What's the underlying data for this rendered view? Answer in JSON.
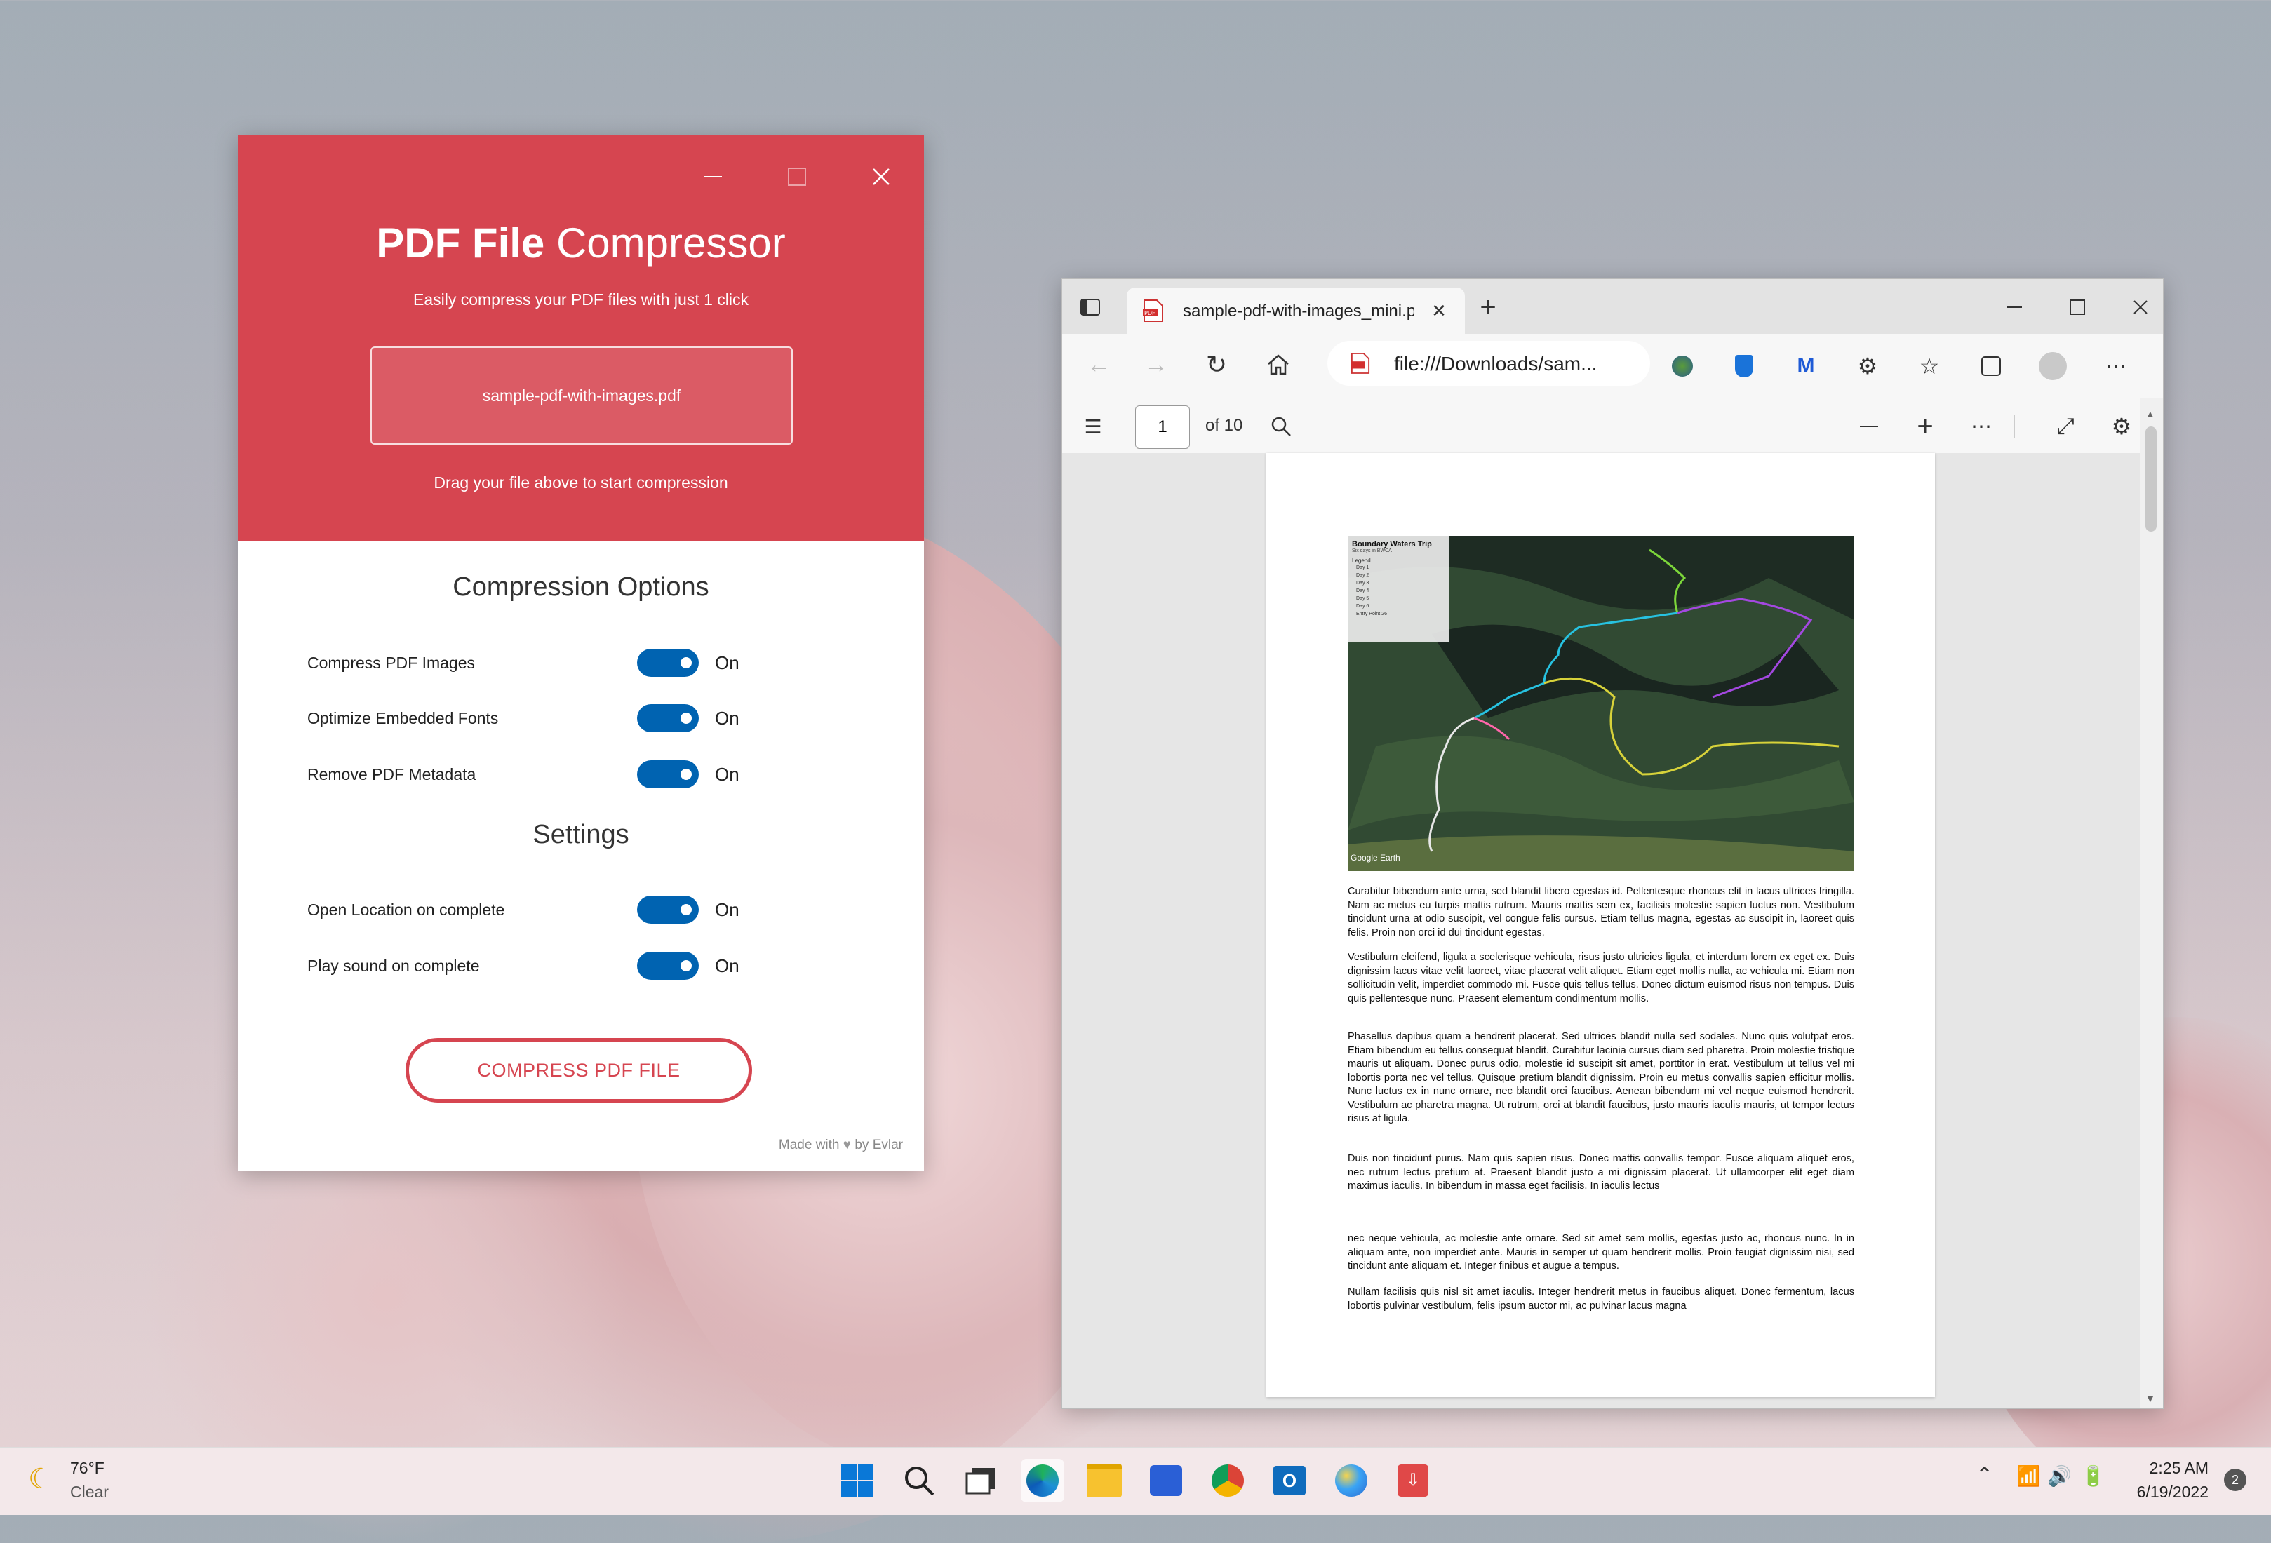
{
  "compressor": {
    "title_bold": "PDF File",
    "title_light": "Compressor",
    "subtitle": "Easily compress your PDF files with just 1 click",
    "file_name": "sample-pdf-with-images.pdf",
    "drag_hint": "Drag your file above to start compression",
    "compression_section": "Compression Options",
    "settings_section": "Settings",
    "options": [
      {
        "label": "Compress PDF Images",
        "state": "On"
      },
      {
        "label": "Optimize Embedded Fonts",
        "state": "On"
      },
      {
        "label": "Remove PDF Metadata",
        "state": "On"
      }
    ],
    "settings": [
      {
        "label": "Open Location on complete",
        "state": "On"
      },
      {
        "label": "Play sound on complete",
        "state": "On"
      }
    ],
    "compress_button": "COMPRESS PDF FILE",
    "made_with": "Made with",
    "by": "by Evlar",
    "accent": "#d64550",
    "toggle_color": "#0063b1"
  },
  "browser": {
    "tab_title": "sample-pdf-with-images_mini.pdf",
    "address": "file:///Downloads/sam...",
    "page_number": "1",
    "page_total": "of 10",
    "map": {
      "title": "Boundary Waters Trip",
      "subtitle": "Six days in BWCA",
      "legend_title": "Legend",
      "legend_items": [
        "Day 1",
        "Day 2",
        "Day 3",
        "Day 4",
        "Day 5",
        "Day 6",
        "Entry Point 26"
      ],
      "watermark": "Google Earth"
    },
    "paragraphs": [
      "Curabitur bibendum ante urna, sed blandit libero egestas id. Pellentesque rhoncus elit in lacus ultrices fringilla. Nam ac metus eu turpis mattis rutrum. Mauris mattis sem ex, facilisis molestie sapien luctus non. Vestibulum tincidunt urna at odio suscipit, vel congue felis cursus. Etiam tellus magna, egestas ac suscipit in, laoreet quis felis. Proin non orci id dui tincidunt egestas.",
      "Vestibulum eleifend, ligula a scelerisque vehicula, risus justo ultricies ligula, et interdum lorem ex eget ex. Duis dignissim lacus vitae velit laoreet, vitae placerat velit aliquet. Etiam eget mollis nulla, ac vehicula mi. Etiam non sollicitudin velit, imperdiet commodo mi. Fusce quis tellus tellus. Donec dictum euismod risus non tempus. Duis quis pellentesque nunc. Praesent elementum condimentum mollis.",
      "Phasellus dapibus quam a hendrerit placerat. Sed ultrices blandit nulla sed sodales. Nunc quis volutpat eros. Etiam bibendum eu tellus consequat blandit. Curabitur lacinia cursus diam sed pharetra. Proin molestie tristique mauris ut aliquam. Donec purus odio, molestie id suscipit sit amet, porttitor in erat. Vestibulum ut tellus vel mi lobortis porta nec vel tellus. Quisque pretium blandit dignissim. Proin eu metus convallis sapien efficitur mollis. Nunc luctus ex in nunc ornare, nec blandit orci faucibus. Aenean bibendum mi vel neque euismod hendrerit. Vestibulum ac pharetra magna. Ut rutrum, orci at blandit faucibus, justo mauris iaculis mauris, ut tempor lectus risus at ligula.",
      "Duis non tincidunt purus. Nam quis sapien risus. Donec mattis convallis tempor. Fusce aliquam aliquet eros, nec rutrum lectus pretium at. Praesent blandit justo a mi dignissim placerat. Ut ullamcorper elit eget diam maximus iaculis. In bibendum in massa eget facilisis. In iaculis lectus",
      "nec neque vehicula, ac molestie ante ornare. Sed sit amet sem mollis, egestas justo ac, rhoncus nunc. In in aliquam ante, non imperdiet ante. Mauris in semper ut quam hendrerit mollis. Proin feugiat dignissim nisi, sed tincidunt ante aliquam et. Integer finibus et augue a tempus.",
      "Nullam facilisis quis nisl sit amet iaculis. Integer hendrerit metus in faucibus aliquet. Donec fermentum, lacus lobortis pulvinar vestibulum, felis ipsum auctor mi, ac pulvinar lacus magna"
    ]
  },
  "taskbar": {
    "weather_temp": "76°F",
    "weather_desc": "Clear",
    "time": "2:25 AM",
    "date": "6/19/2022",
    "notification_count": "2"
  }
}
